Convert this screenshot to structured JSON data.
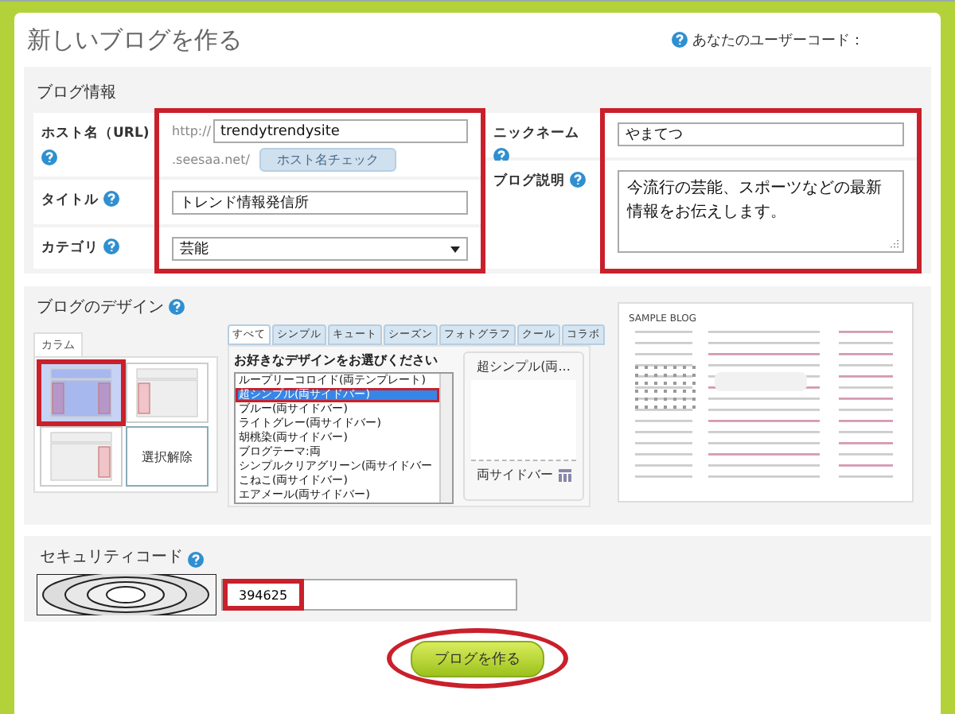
{
  "header": {
    "title": "新しいブログを作る",
    "user_code_label": "あなたのユーザーコード："
  },
  "blog_info": {
    "heading": "ブログ情報",
    "host": {
      "label": "ホスト名（URL)",
      "prefix": "http://",
      "value": "trendytrendysite",
      "suffix": ".seesaa.net/",
      "check_button": "ホスト名チェック"
    },
    "title": {
      "label": "タイトル",
      "value": "トレンド情報発信所"
    },
    "category": {
      "label": "カテゴリ",
      "value": "芸能"
    },
    "nickname": {
      "label": "ニックネーム",
      "value": "やまてつ"
    },
    "description": {
      "label": "ブログ説明",
      "value": "今流行の芸能、スポーツなどの最新情報をお伝えします。"
    },
    "left_highlighted": true,
    "right_highlighted": true
  },
  "design": {
    "heading": "ブログのデザイン",
    "column_tab": "カラム",
    "columns": [
      {
        "kind": "both",
        "selected": true,
        "highlighted": true
      },
      {
        "kind": "left",
        "selected": false,
        "highlighted": false
      },
      {
        "kind": "right",
        "selected": false,
        "highlighted": false
      },
      {
        "kind": "button",
        "label": "選択解除",
        "selected": false,
        "highlighted": false
      }
    ],
    "tabs": [
      {
        "label": "すべて",
        "selected": true
      },
      {
        "label": "シンプル",
        "selected": false
      },
      {
        "label": "キュート",
        "selected": false
      },
      {
        "label": "シーズン",
        "selected": false
      },
      {
        "label": "フォトグラフ",
        "selected": false
      },
      {
        "label": "クール",
        "selected": false
      },
      {
        "label": "コラボ",
        "selected": false
      }
    ],
    "list_title": "お好きなデザインをお選びください",
    "designs": [
      {
        "label": "ループリーコロイド(両テンプレート)",
        "selected": false,
        "highlighted": false
      },
      {
        "label": "超シンプル(両サイドバー)",
        "selected": true,
        "highlighted": true
      },
      {
        "label": "ブルー(両サイドバー)",
        "selected": false,
        "highlighted": false
      },
      {
        "label": "ライトグレー(両サイドバー)",
        "selected": false,
        "highlighted": false
      },
      {
        "label": "胡桃染(両サイドバー)",
        "selected": false,
        "highlighted": false
      },
      {
        "label": "ブログテーマ:両",
        "selected": false,
        "highlighted": false
      },
      {
        "label": "シンプルクリアグリーン(両サイドバー",
        "selected": false,
        "highlighted": false
      },
      {
        "label": "こねこ(両サイドバー)",
        "selected": false,
        "highlighted": false
      },
      {
        "label": "エアメール(両サイドバー)",
        "selected": false,
        "highlighted": false
      }
    ],
    "preview_name": "超シンプル(両...",
    "preview_layout": "両サイドバー",
    "sample_title": "SAMPLE BLOG"
  },
  "security": {
    "label": "セキュリティコード",
    "value": "394625",
    "highlighted": true
  },
  "submit": {
    "label": "ブログを作る",
    "highlighted": true
  }
}
